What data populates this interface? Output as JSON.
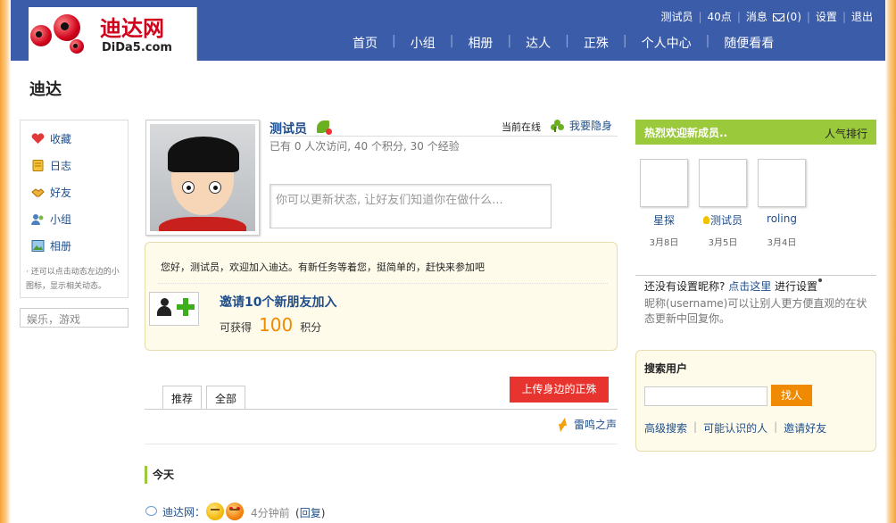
{
  "header": {
    "logo_cn": "迪达网",
    "logo_en": "DiDa5.com",
    "user": "测试员",
    "points": "40点",
    "messages": "消息",
    "mail_count": "(0)",
    "settings": "设置",
    "logout": "退出",
    "nav": [
      "首页",
      "小组",
      "相册",
      "达人",
      "正殊",
      "个人中心",
      "随便看看"
    ]
  },
  "page_title": "迪达",
  "sidebar": {
    "items": [
      {
        "label": "收藏",
        "icon": "heart-icon"
      },
      {
        "label": "日志",
        "icon": "notebook-icon"
      },
      {
        "label": "好友",
        "icon": "handshake-icon"
      },
      {
        "label": "小组",
        "icon": "group-icon"
      },
      {
        "label": "相册",
        "icon": "photo-icon"
      }
    ],
    "note": "· 还可以点击动态左边的小图标，显示相关动态。",
    "tags": "娱乐，游戏"
  },
  "profile": {
    "name": "测试员",
    "online_status": "当前在线",
    "hide_link": "我要隐身",
    "stats": "已有 0 人次访问, 40 个积分, 30 个经验",
    "status_placeholder": "你可以更新状态, 让好友们知道你在做什么..."
  },
  "task": {
    "message": "您好，测试员，欢迎加入迪达。有新任务等着您，挺简单的，赶快来参加吧",
    "title": "邀请10个新朋友加入",
    "reward_prefix": "可获得",
    "reward_value": "100",
    "reward_suffix": "积分"
  },
  "feed": {
    "tabs": [
      "推荐",
      "全部"
    ],
    "upload_button": "上传身边的正殊",
    "thunder_link": "雷鸣之声",
    "today_label": "今天",
    "item": {
      "user": "迪达网",
      "colon": "：",
      "time": "4分钟前",
      "reply_open": "(",
      "reply": "回复",
      "reply_close": ")"
    }
  },
  "right": {
    "welcome_title": "热烈欢迎新成员..",
    "popular_rank": "人气排行",
    "members": [
      {
        "name": "星探",
        "date": "3月8日"
      },
      {
        "name": "测试员",
        "date": "3月5日"
      },
      {
        "name": "roling",
        "date": "3月4日"
      }
    ],
    "nickname_prompt": "还没有设置昵称?",
    "nickname_link": "点击这里",
    "nickname_suffix": "进行设置",
    "nickname_desc": "昵称(username)可以让别人更方便直观的在状态更新中回复你。",
    "search_title": "搜索用户",
    "search_button": "找人",
    "search_links": [
      "高级搜索",
      "可能认识的人",
      "邀请好友"
    ]
  },
  "colors": {
    "header_bg": "#3b5ca8",
    "link": "#1f4e8a",
    "accent_green": "#9bc93c",
    "upload_red": "#e8342f",
    "orange": "#f08a00"
  }
}
